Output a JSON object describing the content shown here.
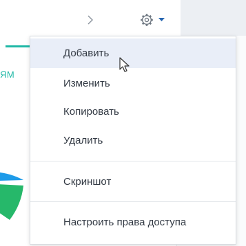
{
  "widget": {
    "caption": "ЯМ",
    "colors": {
      "accent": "#1fb8a6",
      "pie_blue": "#1e9be9",
      "pie_green": "#26b86a"
    }
  },
  "header": {
    "chevron_icon": "chevron-right-icon",
    "gear_icon": "gear-icon",
    "caret_icon": "caret-down-icon",
    "caret_color": "#2565b0"
  },
  "menu": {
    "items": [
      {
        "label": "Добавить",
        "highlighted": true
      },
      {
        "label": "Изменить"
      },
      {
        "label": "Копировать"
      },
      {
        "label": "Удалить"
      },
      {
        "label": "Скриншот"
      },
      {
        "label": "Настроить права доступа"
      }
    ],
    "highlight_color": "#e9eef8"
  }
}
